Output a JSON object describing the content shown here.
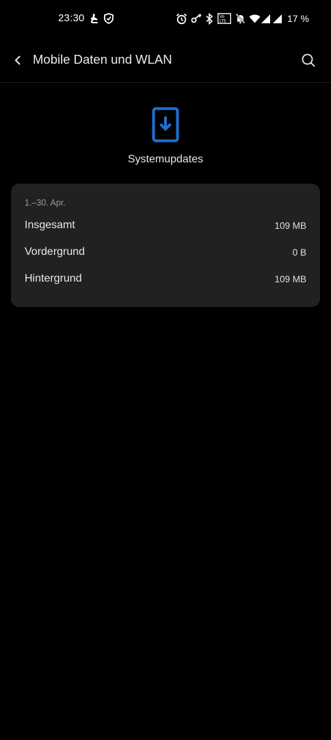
{
  "status_bar": {
    "time": "23:30",
    "battery_percent": "17 %",
    "icons": [
      "app-notification-icon",
      "shield-icon",
      "alarm-icon",
      "vpn-key-icon",
      "bluetooth-icon",
      "volte-icon",
      "mute-icon",
      "wifi-icon",
      "signal-icon",
      "signal-icon-2"
    ]
  },
  "toolbar": {
    "title": "Mobile Daten und WLAN"
  },
  "app": {
    "name": "Systemupdates",
    "icon": "system-update-icon",
    "accent_color": "#1f6fd6"
  },
  "usage": {
    "period": "1.–30. Apr.",
    "rows": [
      {
        "label": "Insgesamt",
        "value": "109 MB"
      },
      {
        "label": "Vordergrund",
        "value": "0 B"
      },
      {
        "label": "Hintergrund",
        "value": "109 MB"
      }
    ]
  },
  "colors": {
    "background": "#000000",
    "card": "#212121"
  }
}
